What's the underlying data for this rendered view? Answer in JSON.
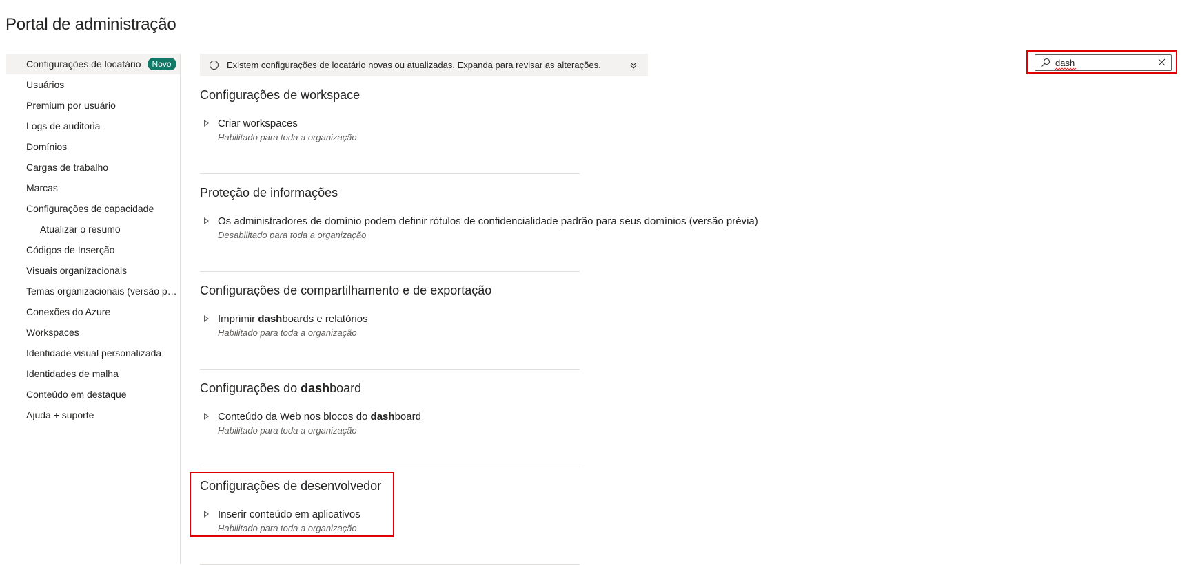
{
  "page_title": "Portal de administração",
  "sidebar": {
    "items": [
      {
        "label": "Configurações de locatário",
        "badge": "Novo",
        "active": true
      },
      {
        "label": "Usuários"
      },
      {
        "label": "Premium por usuário"
      },
      {
        "label": "Logs de auditoria"
      },
      {
        "label": "Domínios"
      },
      {
        "label": "Cargas de trabalho"
      },
      {
        "label": "Marcas"
      },
      {
        "label": "Configurações de capacidade"
      },
      {
        "label": "Atualizar o resumo",
        "sub": true
      },
      {
        "label": "Códigos de Inserção"
      },
      {
        "label": "Visuais organizacionais"
      },
      {
        "label": "Temas organizacionais (versão prévia)"
      },
      {
        "label": "Conexões do Azure"
      },
      {
        "label": "Workspaces"
      },
      {
        "label": "Identidade visual personalizada"
      },
      {
        "label": "Identidades de malha"
      },
      {
        "label": "Conteúdo em destaque"
      },
      {
        "label": "Ajuda + suporte"
      }
    ]
  },
  "banner": {
    "text": "Existem configurações de locatário novas ou atualizadas. Expanda para revisar as alterações.",
    "icon": "info-icon"
  },
  "search": {
    "value": "dash",
    "icon": "search-icon",
    "clear_icon": "close-icon"
  },
  "sections": [
    {
      "title": [
        "Configurações de workspace"
      ],
      "setting": {
        "name": [
          "Criar workspaces"
        ],
        "status": "Habilitado para toda a organização"
      }
    },
    {
      "title": [
        "Proteção de informações"
      ],
      "setting": {
        "name": [
          "Os administradores de domínio podem definir rótulos de confidencialidade padrão para seus domínios (versão prévia)"
        ],
        "status": "Desabilitado para toda a organização"
      }
    },
    {
      "title": [
        "Configurações de compartilhamento e de exportação"
      ],
      "setting": {
        "name": [
          "Imprimir ",
          "dash",
          "boards e relatórios"
        ],
        "status": "Habilitado para toda a organização"
      }
    },
    {
      "title": [
        "Configurações do ",
        "dash",
        "board"
      ],
      "setting": {
        "name": [
          "Conteúdo da Web nos blocos do ",
          "dash",
          "board"
        ],
        "status": "Habilitado para toda a organização"
      }
    },
    {
      "title": [
        "Configurações de desenvolvedor"
      ],
      "setting": {
        "name": [
          "Inserir conteúdo em aplicativos"
        ],
        "status": "Habilitado para toda a organização"
      }
    }
  ],
  "colors": {
    "accent_badge": "#117865",
    "highlight_box": "#e00000",
    "banner_bg": "#f3f2f1"
  }
}
